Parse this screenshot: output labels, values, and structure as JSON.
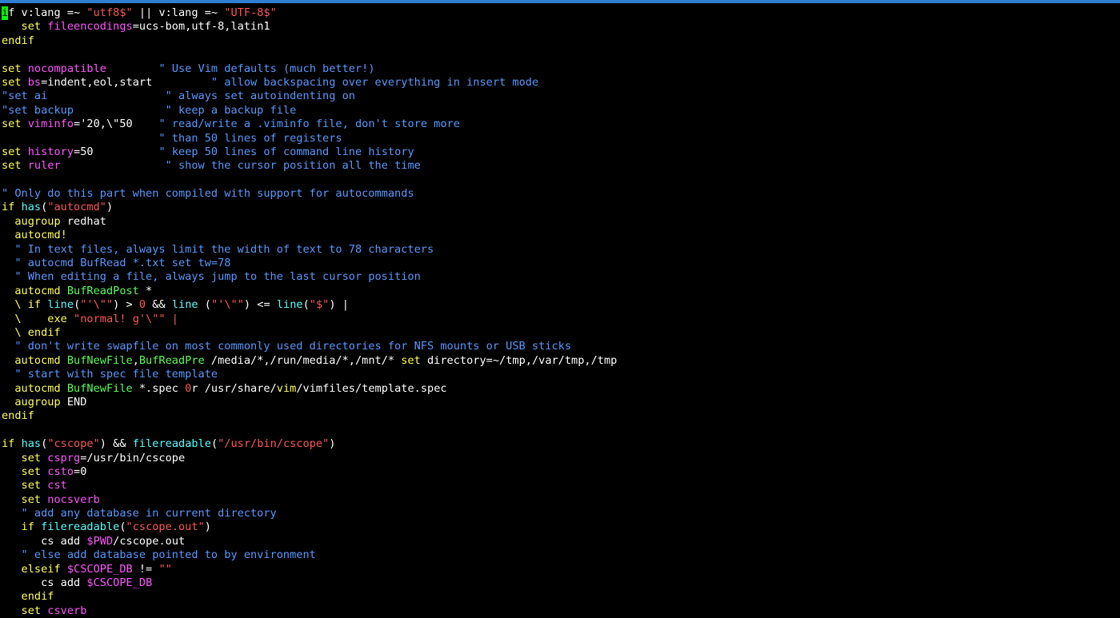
{
  "colors": {
    "plain": "#ffffff",
    "keyword": "#ffff55",
    "string": "#ff5555",
    "option": "#ff55ff",
    "comment": "#5599ff",
    "function": "#55ffff",
    "event": "#55ff55",
    "cursor": "#00ff00",
    "topbar": "#2e7fd1"
  },
  "editor": {
    "cursor_char": "i",
    "lines": [
      [
        [
          "plain",
          "f v:lang =~ "
        ],
        [
          "string",
          "\"utf8$\""
        ],
        [
          "plain",
          " || v:lang =~ "
        ],
        [
          "string",
          "\"UTF-8$\""
        ]
      ],
      [
        [
          "keyword",
          "   set "
        ],
        [
          "option",
          "fileencodings"
        ],
        [
          "plain",
          "=ucs-bom,utf-8,latin1"
        ]
      ],
      [
        [
          "keyword",
          "endif"
        ]
      ],
      [],
      [
        [
          "keyword",
          "set "
        ],
        [
          "option",
          "nocompatible"
        ],
        [
          "plain",
          "        "
        ],
        [
          "comment",
          "\" Use Vim defaults (much better!)"
        ]
      ],
      [
        [
          "keyword",
          "set "
        ],
        [
          "option",
          "bs"
        ],
        [
          "plain",
          "=indent,eol,start         "
        ],
        [
          "comment",
          "\" allow backspacing over everything in insert mode"
        ]
      ],
      [
        [
          "comment",
          "\"set ai                  \" always set autoindenting on"
        ]
      ],
      [
        [
          "comment",
          "\"set backup              \" keep a backup file"
        ]
      ],
      [
        [
          "keyword",
          "set "
        ],
        [
          "option",
          "viminfo"
        ],
        [
          "plain",
          "='20,\\\"50    "
        ],
        [
          "comment",
          "\" read/write a .viminfo file, don't store more"
        ]
      ],
      [
        [
          "plain",
          "                        "
        ],
        [
          "comment",
          "\" than 50 lines of registers"
        ]
      ],
      [
        [
          "keyword",
          "set "
        ],
        [
          "option",
          "history"
        ],
        [
          "plain",
          "=50          "
        ],
        [
          "comment",
          "\" keep 50 lines of command line history"
        ]
      ],
      [
        [
          "keyword",
          "set "
        ],
        [
          "option",
          "ruler"
        ],
        [
          "plain",
          "                "
        ],
        [
          "comment",
          "\" show the cursor position all the time"
        ]
      ],
      [],
      [
        [
          "comment",
          "\" Only do this part when compiled with support for autocommands"
        ]
      ],
      [
        [
          "keyword",
          "if "
        ],
        [
          "function",
          "has"
        ],
        [
          "plain",
          "("
        ],
        [
          "string",
          "\"autocmd\""
        ],
        [
          "plain",
          ")"
        ]
      ],
      [
        [
          "keyword",
          "  augroup"
        ],
        [
          "plain",
          " redhat"
        ]
      ],
      [
        [
          "keyword",
          "  autocmd!"
        ]
      ],
      [
        [
          "comment",
          "  \" In text files, always limit the width of text to 78 characters"
        ]
      ],
      [
        [
          "comment",
          "  \" autocmd BufRead *.txt set tw=78"
        ]
      ],
      [
        [
          "comment",
          "  \" When editing a file, always jump to the last cursor position"
        ]
      ],
      [
        [
          "keyword",
          "  autocmd "
        ],
        [
          "event",
          "BufReadPost"
        ],
        [
          "plain",
          " *"
        ]
      ],
      [
        [
          "keyword",
          "  \\ "
        ],
        [
          "keyword",
          "if "
        ],
        [
          "function",
          "line"
        ],
        [
          "plain",
          "("
        ],
        [
          "string",
          "\"'\\\"\""
        ],
        [
          "plain",
          ") > "
        ],
        [
          "string",
          "0"
        ],
        [
          "plain",
          " && "
        ],
        [
          "function",
          "line"
        ],
        [
          "plain",
          " ("
        ],
        [
          "string",
          "\"'\\\"\""
        ],
        [
          "plain",
          ") <= "
        ],
        [
          "function",
          "line"
        ],
        [
          "plain",
          "("
        ],
        [
          "string",
          "\"$\""
        ],
        [
          "plain",
          ") |"
        ]
      ],
      [
        [
          "keyword",
          "  \\    exe "
        ],
        [
          "string",
          "\"normal! g'\\\"\" |"
        ]
      ],
      [
        [
          "keyword",
          "  \\ endif"
        ]
      ],
      [
        [
          "comment",
          "  \" don't write swapfile on most commonly used directories for NFS mounts or USB sticks"
        ]
      ],
      [
        [
          "keyword",
          "  autocmd "
        ],
        [
          "event",
          "BufNewFile"
        ],
        [
          "plain",
          ","
        ],
        [
          "event",
          "BufReadPre"
        ],
        [
          "plain",
          " /media/*,/run/media/*,/mnt/* "
        ],
        [
          "keyword",
          "set "
        ],
        [
          "plain",
          "directory=~/tmp,/var/tmp,/tmp"
        ]
      ],
      [
        [
          "comment",
          "  \" start with spec file template"
        ]
      ],
      [
        [
          "keyword",
          "  autocmd "
        ],
        [
          "event",
          "BufNewFile"
        ],
        [
          "plain",
          " *.spec "
        ],
        [
          "string",
          "0"
        ],
        [
          "plain",
          "r /usr/share/"
        ],
        [
          "keyword",
          "vim"
        ],
        [
          "plain",
          "/vimfiles/template.spec"
        ]
      ],
      [
        [
          "keyword",
          "  augroup"
        ],
        [
          "plain",
          " END"
        ]
      ],
      [
        [
          "keyword",
          "endif"
        ]
      ],
      [],
      [
        [
          "keyword",
          "if "
        ],
        [
          "function",
          "has"
        ],
        [
          "plain",
          "("
        ],
        [
          "string",
          "\"cscope\""
        ],
        [
          "plain",
          ") && "
        ],
        [
          "function",
          "filereadable"
        ],
        [
          "plain",
          "("
        ],
        [
          "string",
          "\"/usr/bin/cscope\""
        ],
        [
          "plain",
          ")"
        ]
      ],
      [
        [
          "keyword",
          "   set "
        ],
        [
          "option",
          "csprg"
        ],
        [
          "plain",
          "=/usr/bin/cscope"
        ]
      ],
      [
        [
          "keyword",
          "   set "
        ],
        [
          "option",
          "csto"
        ],
        [
          "plain",
          "=0"
        ]
      ],
      [
        [
          "keyword",
          "   set "
        ],
        [
          "option",
          "cst"
        ]
      ],
      [
        [
          "keyword",
          "   set "
        ],
        [
          "option",
          "nocsverb"
        ]
      ],
      [
        [
          "comment",
          "   \" add any database in current directory"
        ]
      ],
      [
        [
          "keyword",
          "   if "
        ],
        [
          "function",
          "filereadable"
        ],
        [
          "plain",
          "("
        ],
        [
          "string",
          "\"cscope.out\""
        ],
        [
          "plain",
          ")"
        ]
      ],
      [
        [
          "plain",
          "      cs add "
        ],
        [
          "option",
          "$PWD"
        ],
        [
          "plain",
          "/cscope.out"
        ]
      ],
      [
        [
          "comment",
          "   \" else add database pointed to by environment"
        ]
      ],
      [
        [
          "keyword",
          "   elseif "
        ],
        [
          "option",
          "$CSCOPE_DB"
        ],
        [
          "plain",
          " != "
        ],
        [
          "string",
          "\"\""
        ]
      ],
      [
        [
          "plain",
          "      cs add "
        ],
        [
          "option",
          "$CSCOPE_DB"
        ]
      ],
      [
        [
          "keyword",
          "   endif"
        ]
      ],
      [
        [
          "keyword",
          "   set "
        ],
        [
          "option",
          "csverb"
        ]
      ]
    ]
  }
}
